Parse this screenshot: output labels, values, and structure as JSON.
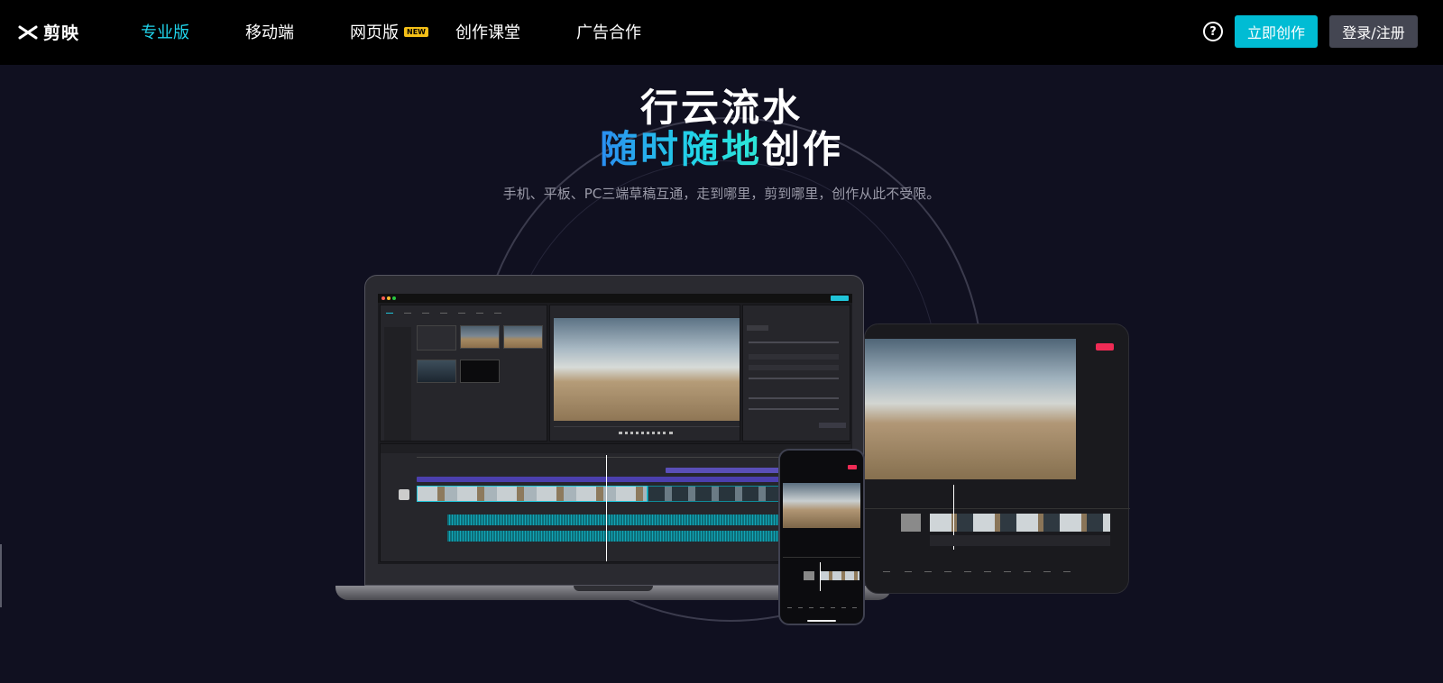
{
  "nav": {
    "logo_text": "剪映",
    "items": [
      {
        "label": "专业版",
        "active": true
      },
      {
        "label": "移动端",
        "active": false
      },
      {
        "label": "网页版",
        "active": false,
        "badge": "NEW"
      },
      {
        "label": "创作课堂",
        "active": false
      },
      {
        "label": "广告合作",
        "active": false
      }
    ],
    "help_icon": "question-circle-icon",
    "create_button": "立即创作",
    "login_button": "登录/注册"
  },
  "hero": {
    "line1": "行云流水",
    "line2_highlight": "随时随地",
    "line2_rest": "创作",
    "subtitle": "手机、平板、PC三端草稿互通，走到哪里，剪到哪里，创作从此不受限。"
  },
  "colors": {
    "accent": "#00bcd4",
    "active_nav": "#20d5ec",
    "badge": "#f5c018",
    "export_red": "#ef2b55",
    "background": "#101020"
  }
}
